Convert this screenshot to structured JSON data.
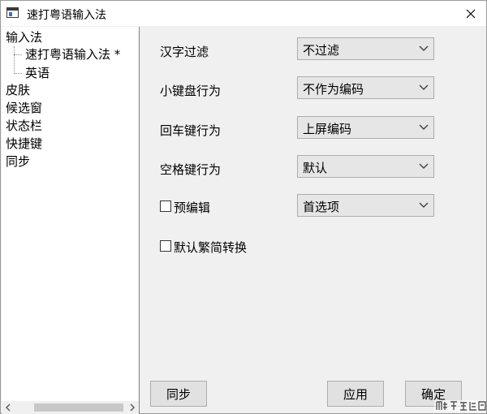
{
  "window": {
    "title": "速打粤语输入法"
  },
  "tree": {
    "items": [
      {
        "label": "输入法"
      },
      {
        "label": "速打粤语输入法 *"
      },
      {
        "label": "英语"
      },
      {
        "label": "皮肤"
      },
      {
        "label": "候选窗"
      },
      {
        "label": "状态栏"
      },
      {
        "label": "快捷键"
      },
      {
        "label": "同步"
      }
    ]
  },
  "settings": {
    "hanzi_filter": {
      "label": "汉字过滤",
      "value": "不过滤"
    },
    "keypad_behavior": {
      "label": "小键盘行为",
      "value": "不作为编码"
    },
    "enter_behavior": {
      "label": "回车键行为",
      "value": "上屏编码"
    },
    "space_behavior": {
      "label": "空格键行为",
      "value": "默认"
    },
    "pre_edit": {
      "label": "预编辑",
      "checked": false,
      "value": "首选项"
    },
    "trad_simp": {
      "label": "默认繁简转换",
      "checked": false
    }
  },
  "buttons": {
    "sync": "同步",
    "apply": "应用",
    "ok": "确定"
  },
  "colors": {
    "window_bg": "#f0f0f0",
    "button_bg": "#e1e1e1",
    "combo_bg": "#e6e6e6",
    "border": "#adadad"
  },
  "icons": {
    "app": "window-app-icon",
    "close": "close-icon",
    "combo_arrow": "chevron-down-icon",
    "scroll_left": "chevron-left-icon",
    "scroll_right": "chevron-right-icon",
    "watermark": "watermark-logo"
  }
}
